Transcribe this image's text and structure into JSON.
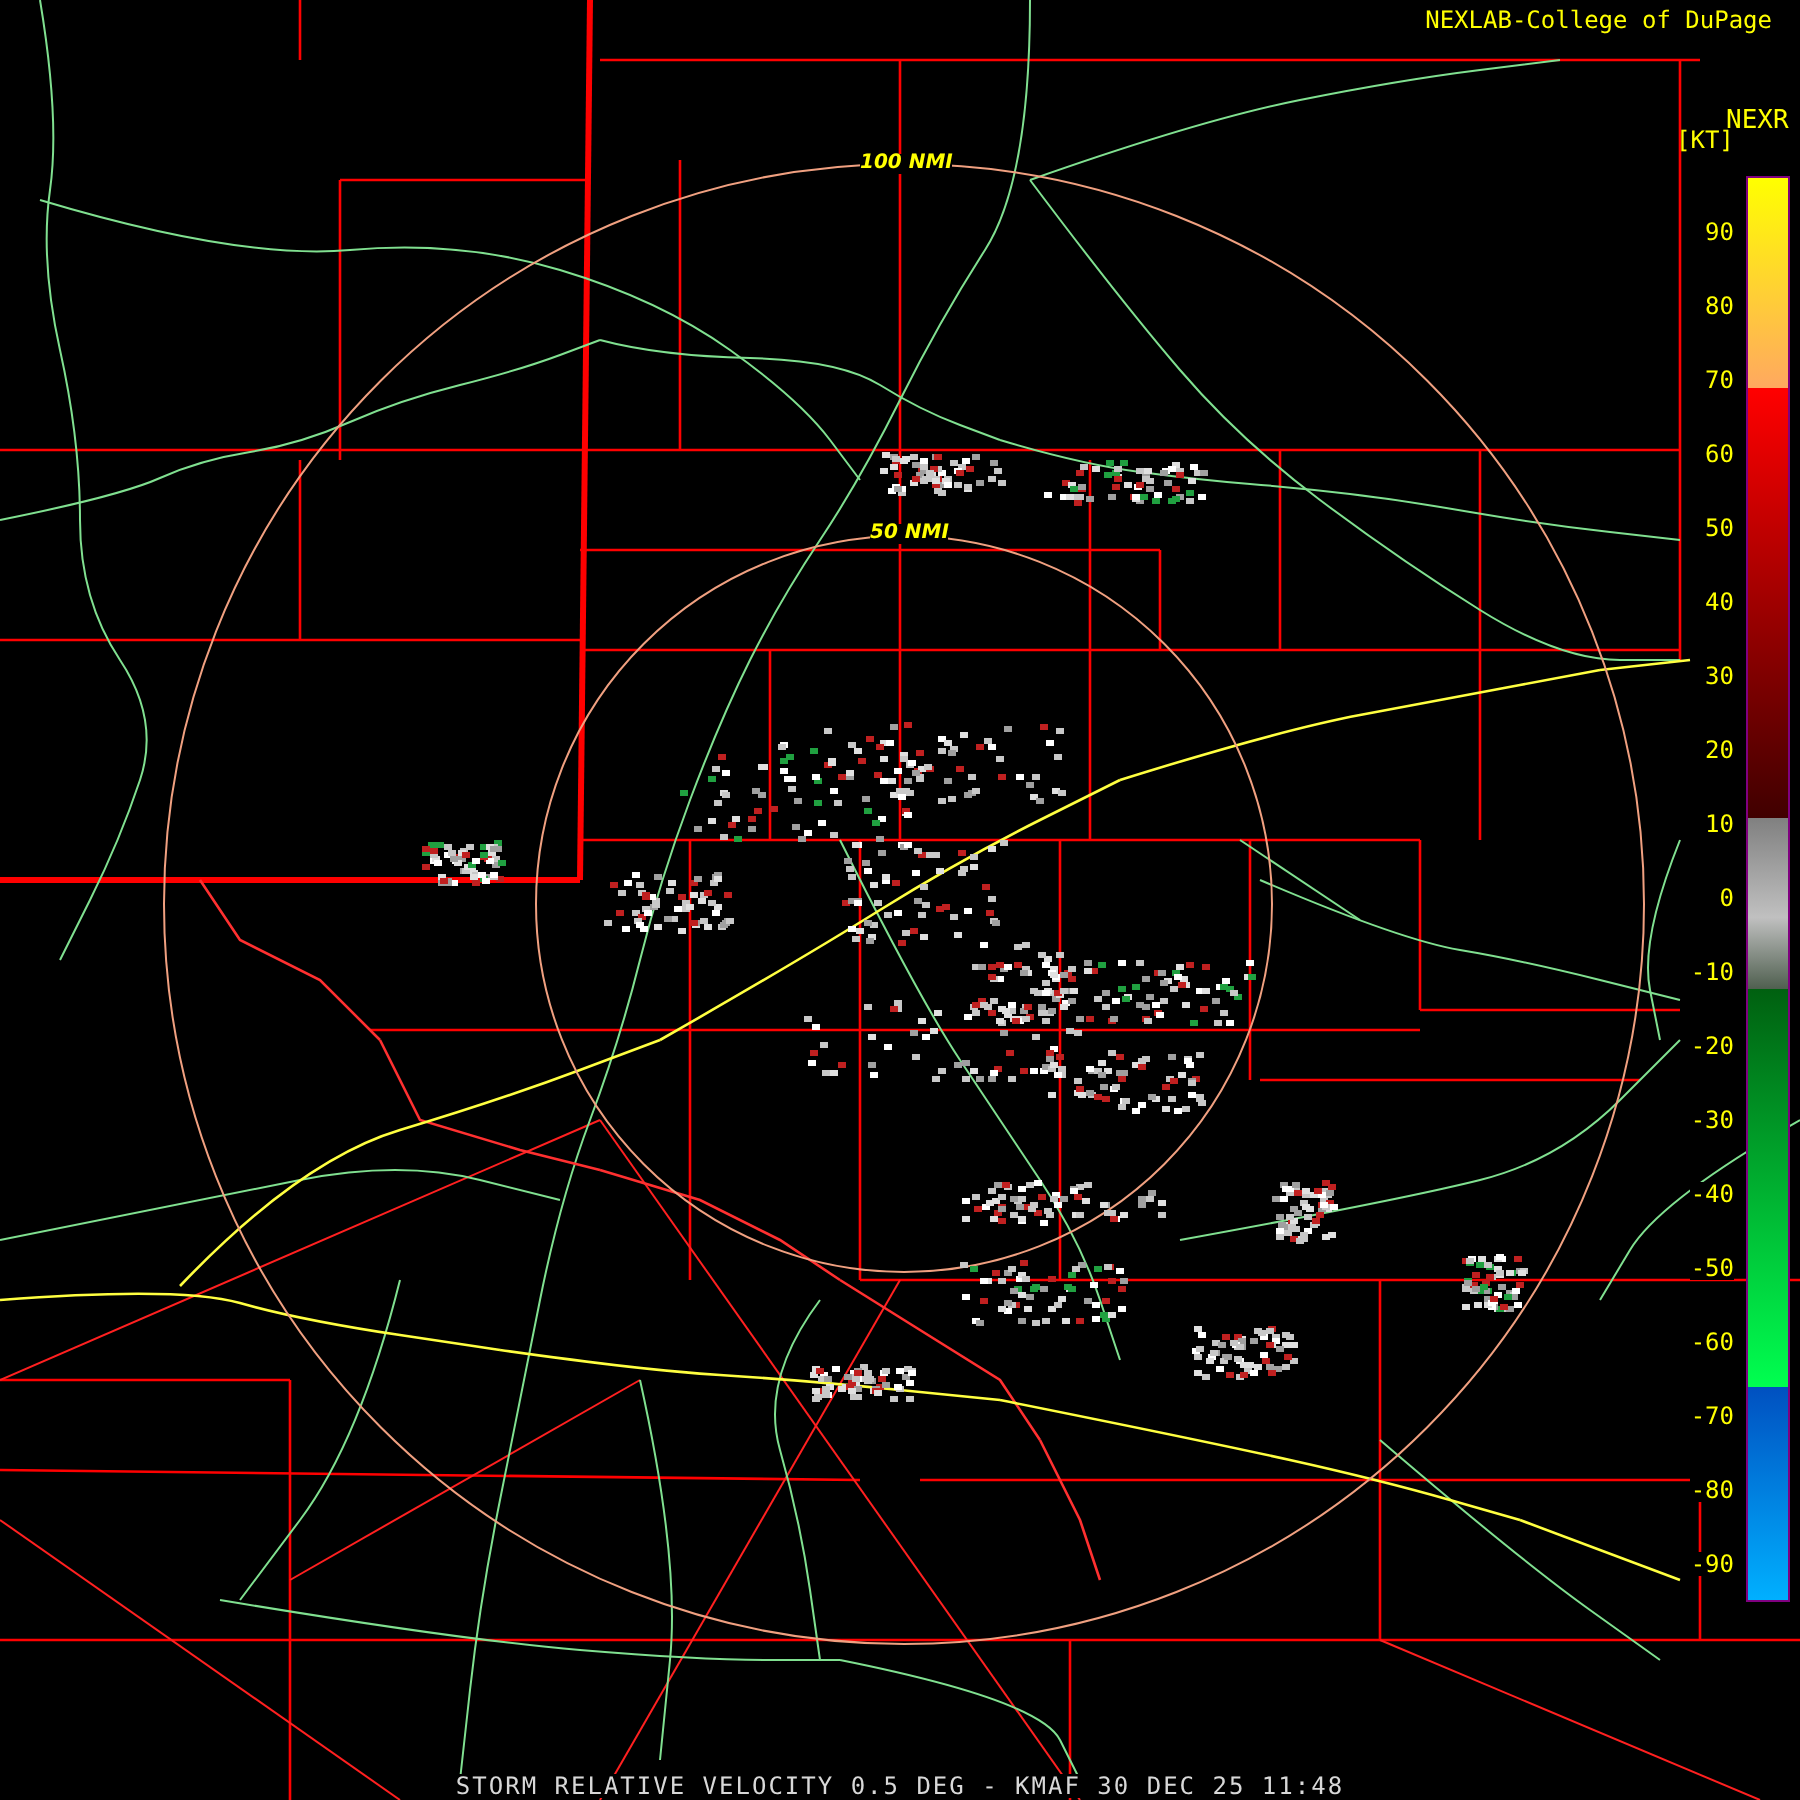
{
  "credit": "NEXLAB-College of DuPage",
  "product": "NEXR",
  "units": "[KT]",
  "range_rings": [
    {
      "label": "100 NMI"
    },
    {
      "label": "50 NMI"
    }
  ],
  "legend": {
    "ticks": [
      "90",
      "80",
      "70",
      "60",
      "50",
      "40",
      "30",
      "20",
      "10",
      "0",
      "-10",
      "-20",
      "-30",
      "-40",
      "-50",
      "-60",
      "-70",
      "-80",
      "-90"
    ]
  },
  "footer": "STORM RELATIVE VELOCITY 0.5 DEG - KMAF 30 DEC 25 11:48"
}
